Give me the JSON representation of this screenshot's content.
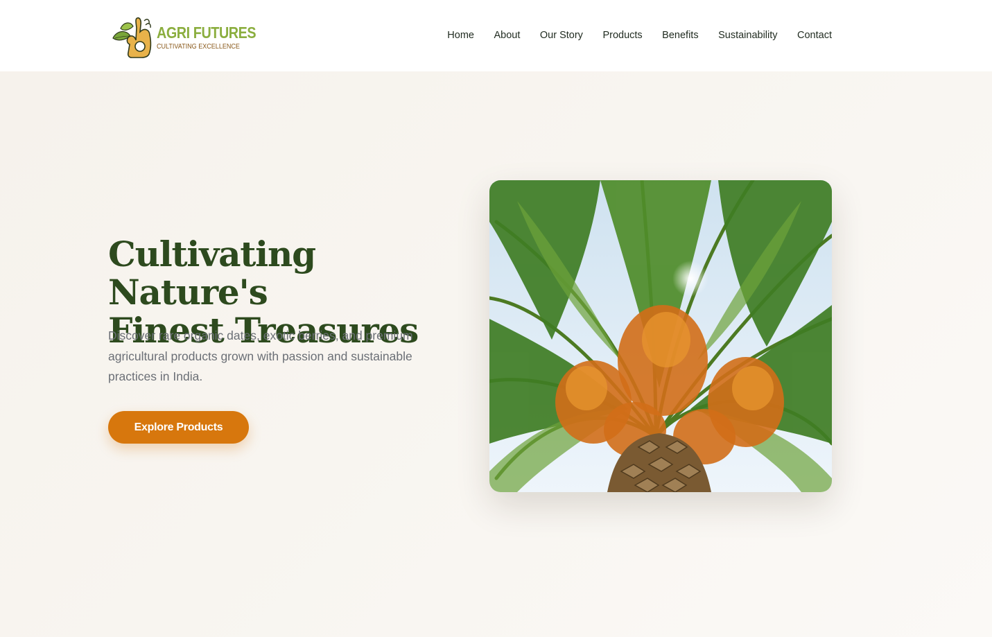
{
  "brand": {
    "name": "AGRI FUTURES",
    "tagline": "CULTIVATING EXCELLENCE",
    "icon": "leaf-ok-hand-logo-icon"
  },
  "nav": {
    "items": [
      {
        "label": "Home"
      },
      {
        "label": "About"
      },
      {
        "label": "Our Story"
      },
      {
        "label": "Products"
      },
      {
        "label": "Benefits"
      },
      {
        "label": "Sustainability"
      },
      {
        "label": "Contact"
      }
    ]
  },
  "hero": {
    "title_line1": "Cultivating Nature's",
    "title_line2": "Finest Treasures",
    "description": "Discover rare organic dates, exotic berries, and premium agricultural products grown with passion and sustainable practices in India.",
    "cta_label": "Explore Products",
    "image_alt": "date palm with orange fruit clusters"
  },
  "colors": {
    "brand_green": "#8bae3f",
    "heading_green": "#2d4a1e",
    "accent_orange": "#d7770d",
    "brand_brown": "#8a5a1c",
    "background": "#f8f5f0"
  }
}
